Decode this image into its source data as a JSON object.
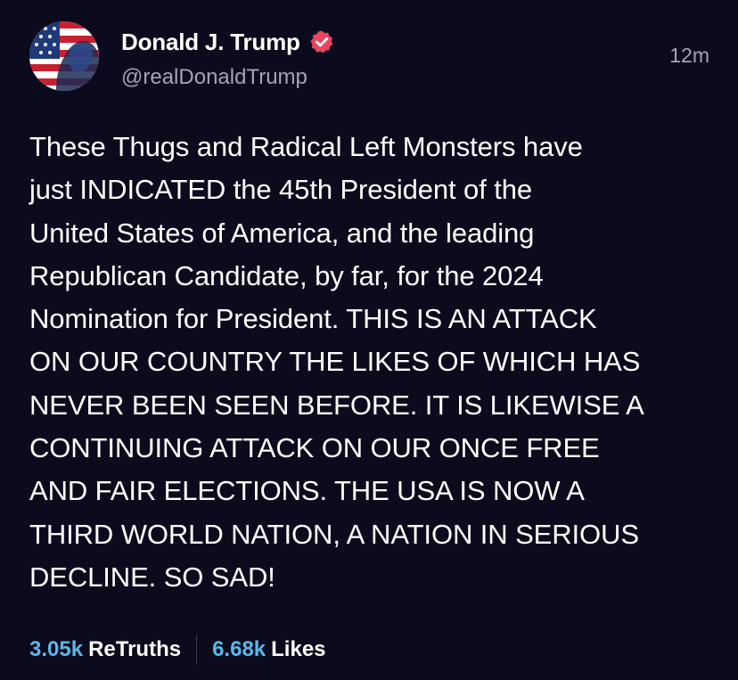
{
  "author": {
    "display_name": "Donald J. Trump",
    "handle": "@realDonaldTrump",
    "verified_icon": "verified-badge-icon",
    "avatar_icon": "avatar-flag-portrait"
  },
  "post": {
    "time": "12m",
    "text": "These Thugs and Radical Left Monsters have\njust INDICATED the 45th President of the\nUnited States of America, and the leading\nRepublican Candidate, by far, for the 2024\nNomination for President. THIS IS AN ATTACK\nON OUR COUNTRY THE LIKES OF WHICH HAS\nNEVER BEEN SEEN BEFORE. IT IS LIKEWISE A\nCONTINUING ATTACK ON OUR ONCE FREE\nAND FAIR ELECTIONS. THE USA IS NOW A\nTHIRD WORLD NATION, A NATION IN SERIOUS\nDECLINE. SO SAD!"
  },
  "stats": {
    "retruths_value": "3.05k",
    "retruths_label": "ReTruths",
    "likes_value": "6.68k",
    "likes_label": "Likes"
  },
  "colors": {
    "background": "#0c0a1d",
    "accent": "#5ab8e8",
    "verified": "#e8455e",
    "muted": "#a6a3b8"
  }
}
